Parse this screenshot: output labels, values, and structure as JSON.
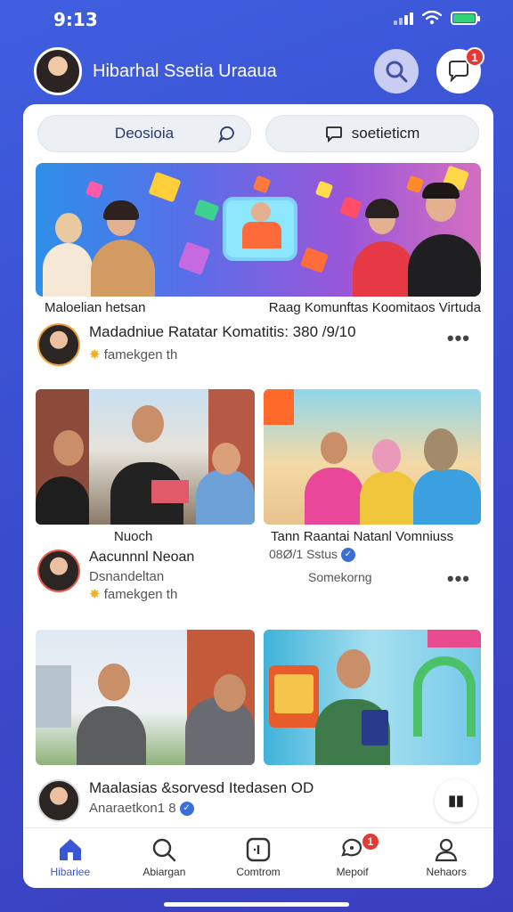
{
  "status": {
    "time": "9:13"
  },
  "header": {
    "title": "Hibarhal Ssetia Uraaua"
  },
  "tabs_top": [
    {
      "label": "Deosioia"
    },
    {
      "label": "soetieticm"
    }
  ],
  "hero": {
    "caption_left": "Maloelian hetsan",
    "caption_right": "Raag Komunftas Koomitaos Virtuda"
  },
  "post1": {
    "name": "Madadniue Ratatar Komatitis: 380 /9/10",
    "meta": "famekgen th"
  },
  "grid1": {
    "left_caption": "Nuoch",
    "right_caption": "Tann Raantai Natanl Vomniuss",
    "right_status": "08Ø/1 Sstus",
    "right_sub": "Somekorng"
  },
  "post2": {
    "name": "Aacunnnl Neoan",
    "line2": "Dsnandeltan",
    "meta": "famekgen th"
  },
  "post3": {
    "name": "Maalasias &sorvesd Itedasen OD",
    "meta": "Anaraetkon1 8"
  },
  "tabbar": [
    {
      "label": "Hibariee",
      "icon": "home-icon",
      "active": true
    },
    {
      "label": "Abiargan",
      "icon": "search-icon",
      "active": false
    },
    {
      "label": "Comtrom",
      "icon": "plus-square-icon",
      "active": false
    },
    {
      "label": "Mepoif",
      "icon": "chat-icon",
      "active": false,
      "badge": "1"
    },
    {
      "label": "Nehaors",
      "icon": "profile-icon",
      "active": false
    }
  ],
  "header_badge": "1",
  "colors": {
    "accent": "#3a56d4",
    "badge": "#e53935",
    "background": "#3f52d6"
  }
}
